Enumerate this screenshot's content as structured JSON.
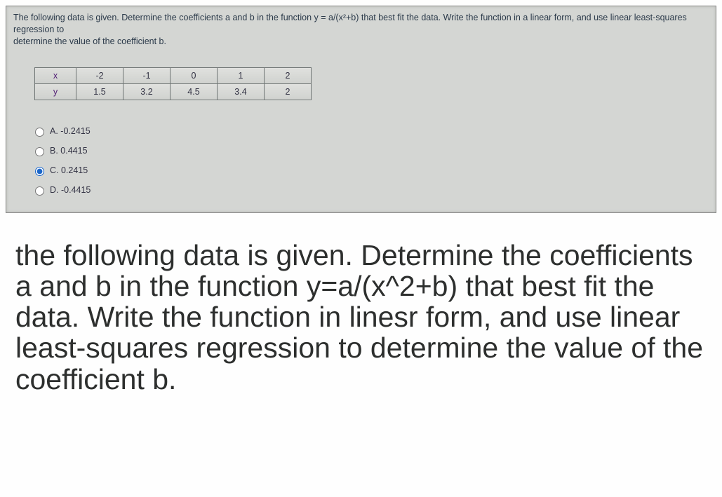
{
  "quiz": {
    "prompt_line1": "The following data is given. Determine the coefficients a and b in the function y = a/(x²+b) that best fit the data. Write the function in a linear form, and use linear least-squares regression to",
    "prompt_line2": "determine the value of the coefficient b.",
    "table": {
      "row1_label": "x",
      "row2_label": "y",
      "x": [
        "-2",
        "-1",
        "0",
        "1",
        "2"
      ],
      "y": [
        "1.5",
        "3.2",
        "4.5",
        "3.4",
        "2"
      ]
    },
    "options": [
      {
        "key": "A",
        "text": "A. -0.2415",
        "selected": false
      },
      {
        "key": "B",
        "text": "B. 0.4415",
        "selected": false
      },
      {
        "key": "C",
        "text": "C. 0.2415",
        "selected": true
      },
      {
        "key": "D",
        "text": "D. -0.4415",
        "selected": false
      }
    ]
  },
  "explanation": "the following data is given. Determine the coefficients a and b in the function y=a/(x^2+b) that best fit the data. Write the function in linesr form, and use linear least-squares regression to determine the value of the coefficient b."
}
